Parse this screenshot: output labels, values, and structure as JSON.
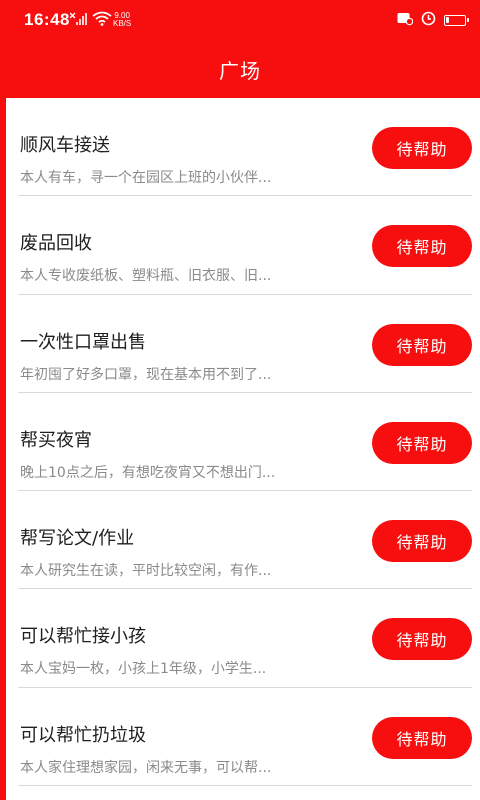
{
  "status_bar": {
    "time": "16:48",
    "net_speed_value": "9.00",
    "net_speed_unit": "KB/S",
    "battery_level": 0.2,
    "icons": [
      "no-signal-icon",
      "wifi-icon",
      "notification-icon",
      "alarm-icon",
      "battery-icon"
    ]
  },
  "header": {
    "title": "广场"
  },
  "colors": {
    "brand_red": "#f70f0f",
    "title_text": "#202020",
    "desc_text": "#8a8a8a",
    "divider": "#d9d9d9"
  },
  "items": [
    {
      "title": "顺风车接送",
      "desc": "本人有车，寻一个在园区上班的小伙伴...",
      "button": "待帮助"
    },
    {
      "title": "废品回收",
      "desc": "本人专收废纸板、塑料瓶、旧衣服、旧...",
      "button": "待帮助"
    },
    {
      "title": "一次性口罩出售",
      "desc": "年初囤了好多口罩，现在基本用不到了...",
      "button": "待帮助"
    },
    {
      "title": "帮买夜宵",
      "desc": "晚上10点之后，有想吃夜宵又不想出门...",
      "button": "待帮助"
    },
    {
      "title": "帮写论文/作业",
      "desc": "本人研究生在读，平时比较空闲，有作...",
      "button": "待帮助"
    },
    {
      "title": "可以帮忙接小孩",
      "desc": "本人宝妈一枚，小孩上1年级，小学生...",
      "button": "待帮助"
    },
    {
      "title": "可以帮忙扔垃圾",
      "desc": "本人家住理想家园，闲来无事，可以帮...",
      "button": "待帮助"
    }
  ]
}
